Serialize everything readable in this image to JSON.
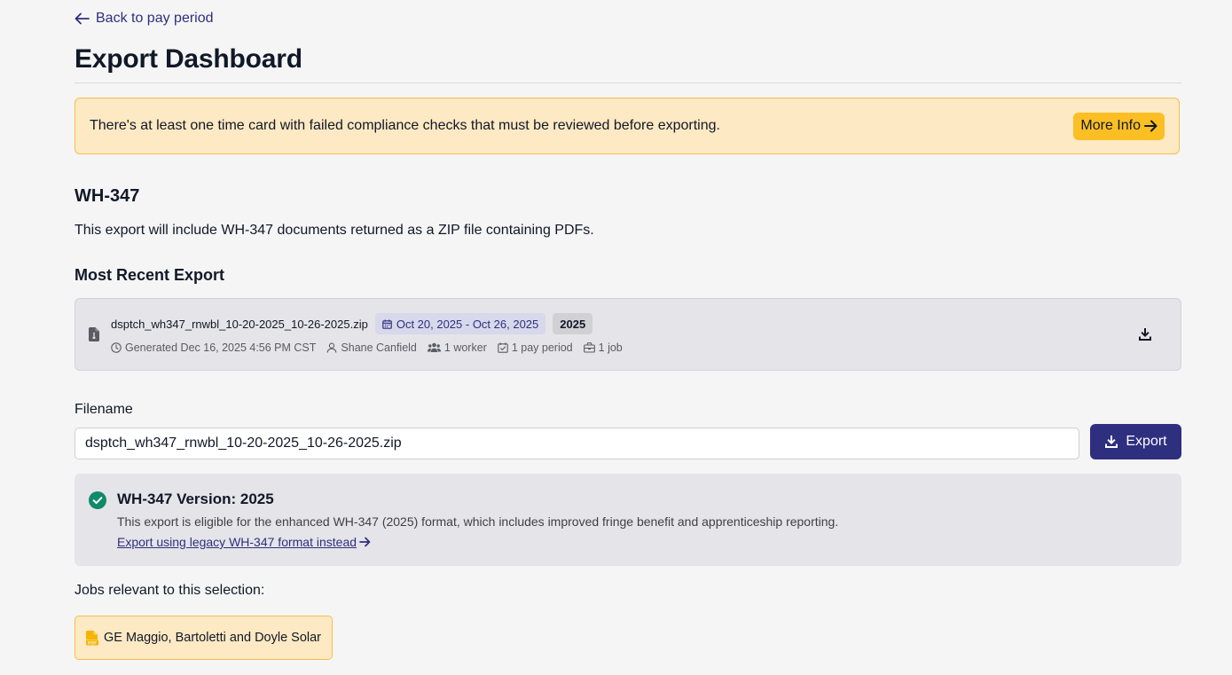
{
  "nav": {
    "back_label": "Back to pay period"
  },
  "page": {
    "title": "Export Dashboard"
  },
  "warning": {
    "message": "There's at least one time card with failed compliance checks that must be reviewed before exporting.",
    "button_label": "More Info"
  },
  "section": {
    "title": "WH-347",
    "description": "This export will include WH-347 documents returned as a ZIP file containing PDFs."
  },
  "recent_export": {
    "heading": "Most Recent Export",
    "filename": "dsptch_wh347_rnwbl_10-20-2025_10-26-2025.zip",
    "date_range": "Oct 20, 2025 - Oct 26, 2025",
    "year": "2025",
    "generated": "Generated Dec 16, 2025 4:56 PM CST",
    "user": "Shane Canfield",
    "workers": "1 worker",
    "pay_periods": "1 pay period",
    "jobs": "1 job"
  },
  "export_form": {
    "filename_label": "Filename",
    "filename_value": "dsptch_wh347_rnwbl_10-20-2025_10-26-2025.zip",
    "export_label": "Export"
  },
  "version": {
    "title": "WH-347 Version: 2025",
    "description": "This export is eligible for the enhanced WH-347 (2025) format, which includes improved fringe benefit and apprenticeship reporting.",
    "legacy_link": "Export using legacy WH-347 format instead"
  },
  "jobs": {
    "label": "Jobs relevant to this selection:",
    "items": [
      {
        "name": "GE Maggio, Bartoletti and Doyle Solar"
      }
    ]
  },
  "colors": {
    "primary": "#2e2f7f",
    "warning_bg": "#fde9c3",
    "warning_border": "#f4c04a",
    "warning_button": "#fbbf24",
    "success": "#0f8a6a"
  }
}
